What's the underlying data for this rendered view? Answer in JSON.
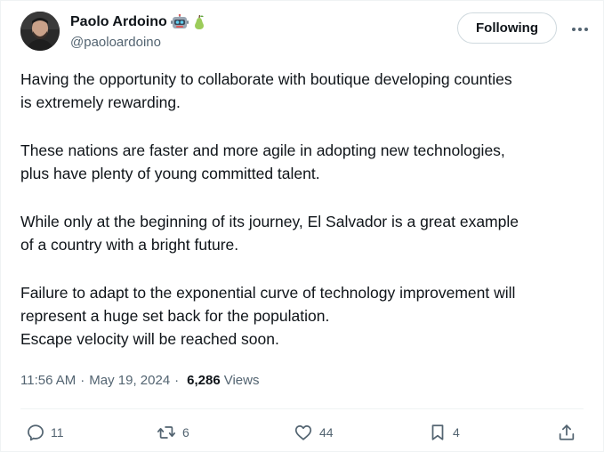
{
  "author": {
    "display_name": "Paolo Ardoino",
    "handle": "@paoloardoino",
    "badges": [
      "robot-emoji-icon",
      "pear-emoji-icon"
    ]
  },
  "follow_button": {
    "label": "Following"
  },
  "tweet": {
    "paragraphs": [
      [
        "Having the opportunity to collaborate with boutique developing counties",
        "is extremely rewarding."
      ],
      [
        "These nations are faster and more agile in adopting new technologies,",
        "plus have plenty of young committed talent."
      ],
      [
        "While only at the beginning of its journey, El Salvador is a great example",
        "of a country with a bright future."
      ],
      [
        "Failure to adapt to the exponential curve of technology improvement will",
        "represent a huge set back for the population.",
        "Escape velocity will be reached soon."
      ]
    ]
  },
  "meta": {
    "time": "11:56 AM",
    "date": "May 19, 2024",
    "views_count": "6,286",
    "views_label": "Views"
  },
  "actions": {
    "replies": "11",
    "reposts": "6",
    "likes": "44",
    "bookmarks": "4"
  },
  "colors": {
    "text": "#0f1419",
    "secondary": "#536471",
    "border": "#cfd9de",
    "divider": "#eff3f4"
  }
}
